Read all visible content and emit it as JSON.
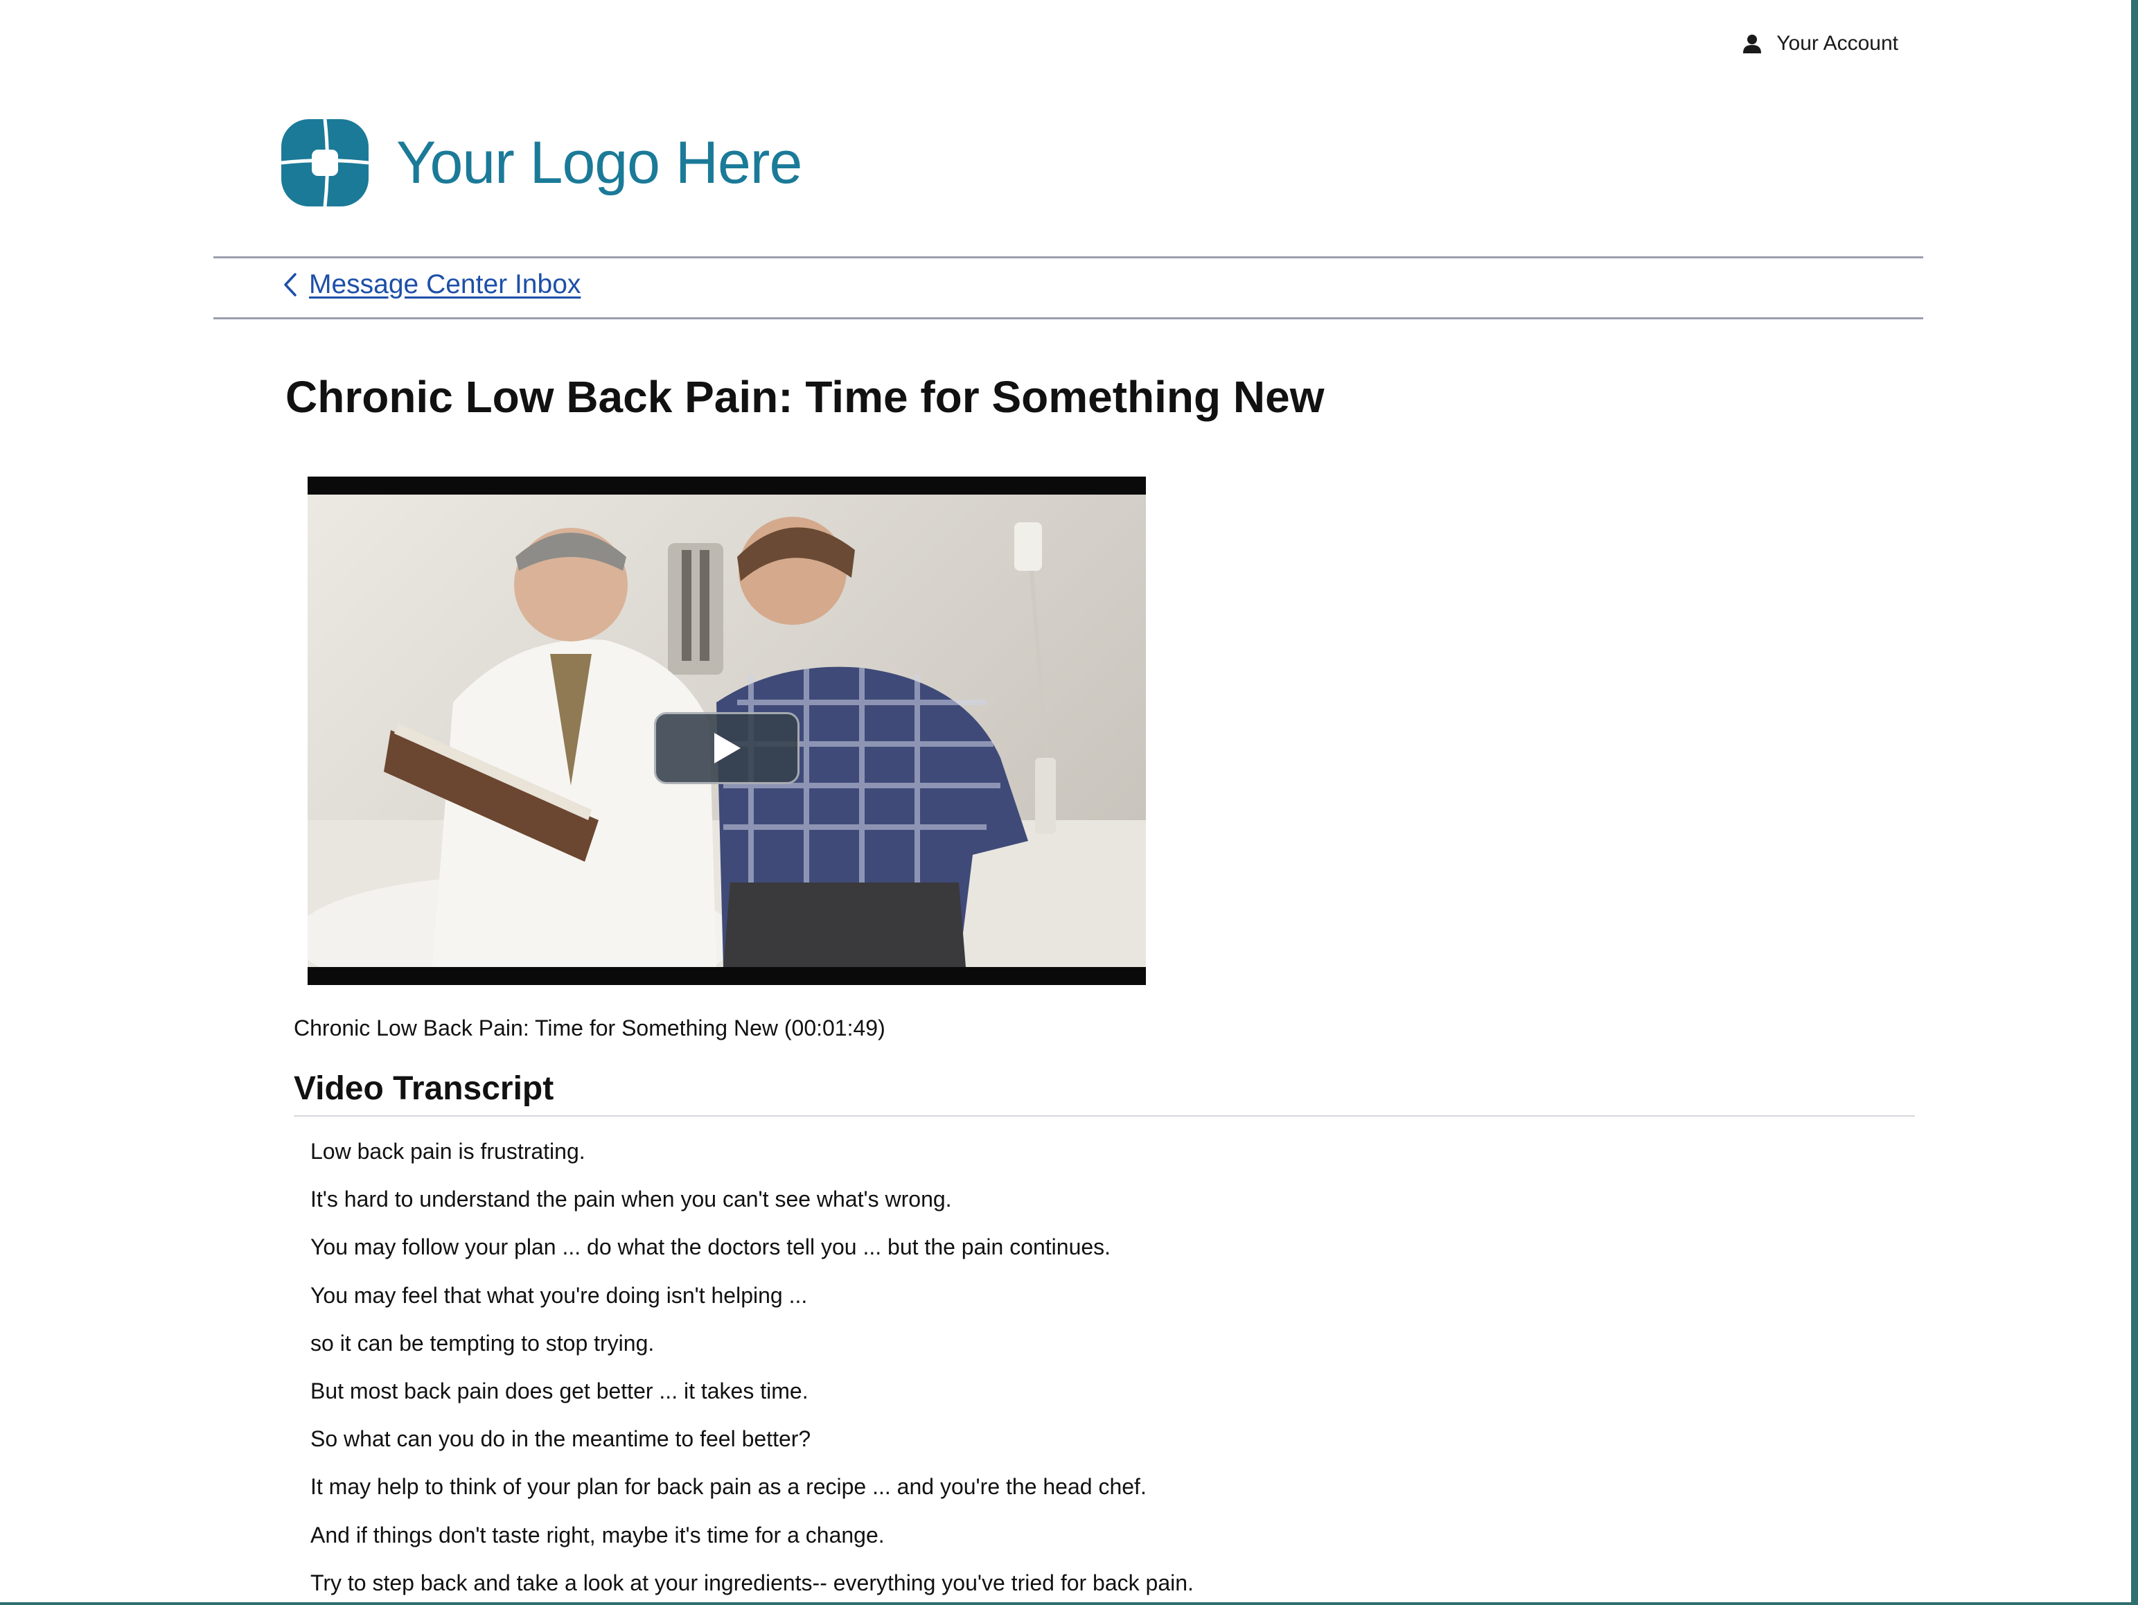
{
  "header": {
    "account_label": "Your Account",
    "account_icon": "user-icon",
    "logo_text": "Your Logo Here",
    "logo_icon": "logo-icon",
    "brand_color": "#1b7a98"
  },
  "nav": {
    "back_icon": "chevron-left-icon",
    "back_label": "Message Center Inbox",
    "link_color": "#1d4fa8"
  },
  "article": {
    "title": "Chronic Low Back Pain: Time for Something New"
  },
  "video": {
    "play_icon": "play-icon",
    "caption": "Chronic Low Back Pain: Time for Something New (00:01:49)"
  },
  "transcript": {
    "heading": "Video Transcript",
    "lines": [
      "Low back pain is frustrating.",
      "It's hard to understand the pain when you can't see what's wrong.",
      "You may follow your plan ... do what the doctors tell you ... but the pain continues.",
      "You may feel that what you're doing isn't helping ...",
      "so it can be tempting to stop trying.",
      "But most back pain does get better ... it takes time.",
      "So what can you do in the meantime to feel better?",
      "It may help to think of your plan for back pain as a recipe ... and you're the head chef.",
      "And if things don't taste right, maybe it's time for a change.",
      "Try to step back and take a look at your ingredients-- everything you've tried for back pain."
    ]
  }
}
